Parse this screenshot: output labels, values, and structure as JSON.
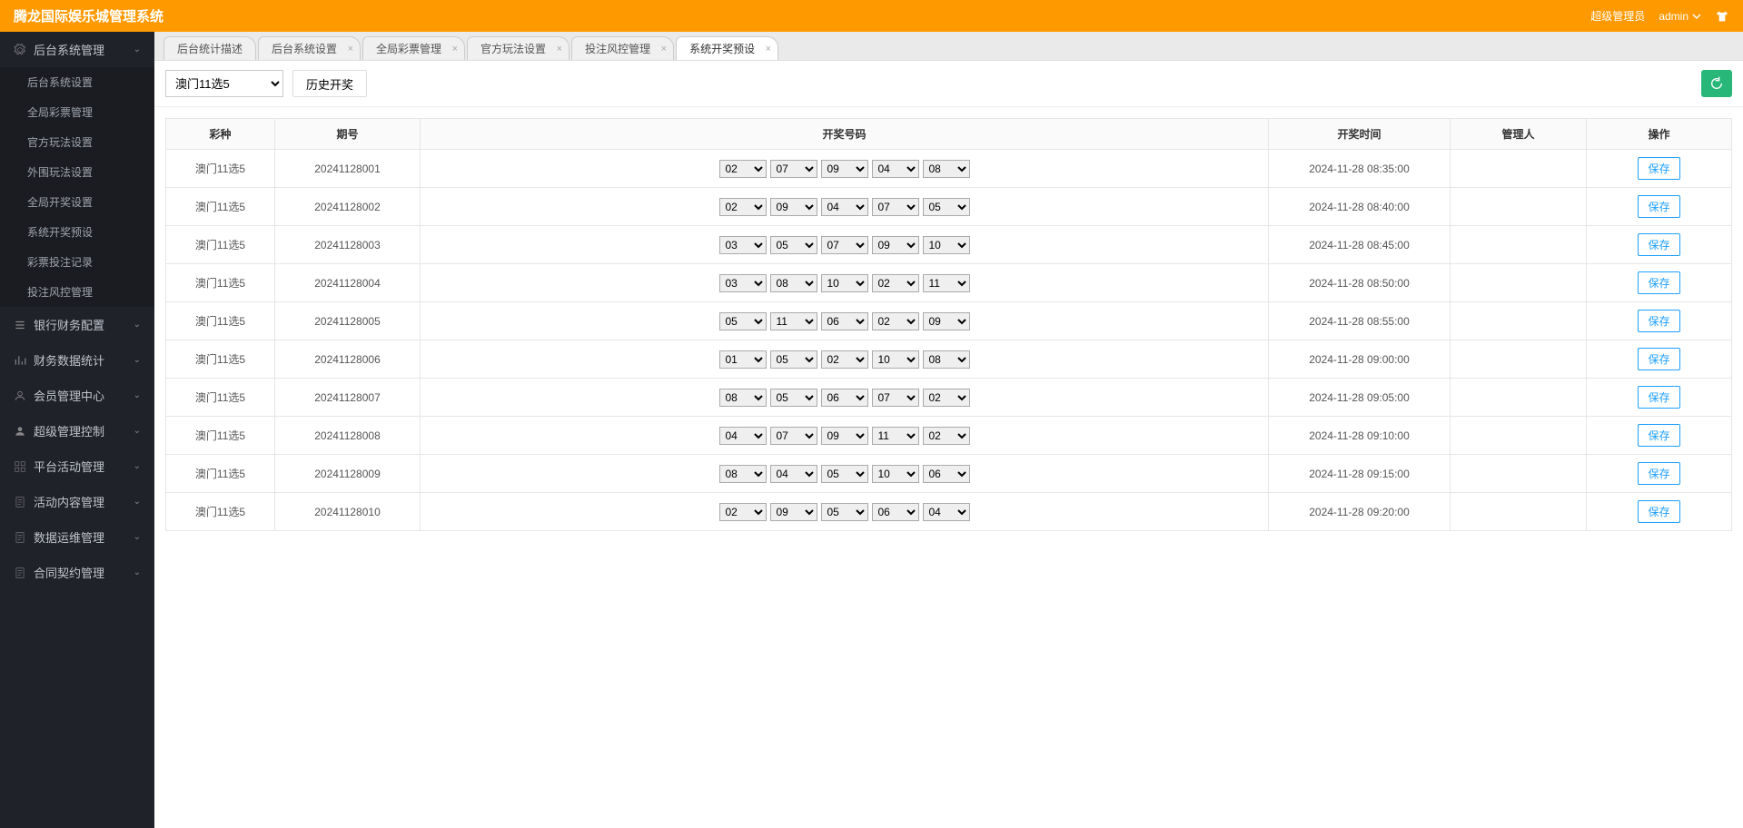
{
  "header": {
    "title": "腾龙国际娱乐城管理系统",
    "user_role": "超级管理员",
    "user_name": "admin"
  },
  "sidebar": [
    {
      "label": "后台系统管理",
      "icon": "gear",
      "expanded": true,
      "items": [
        "后台系统设置",
        "全局彩票管理",
        "官方玩法设置",
        "外围玩法设置",
        "全局开奖设置",
        "系统开奖预设",
        "彩票投注记录",
        "投注风控管理"
      ]
    },
    {
      "label": "银行财务配置",
      "icon": "list",
      "expanded": false
    },
    {
      "label": "财务数据统计",
      "icon": "chart",
      "expanded": false
    },
    {
      "label": "会员管理中心",
      "icon": "user",
      "expanded": false
    },
    {
      "label": "超级管理控制",
      "icon": "person",
      "expanded": false
    },
    {
      "label": "平台活动管理",
      "icon": "grid",
      "expanded": false
    },
    {
      "label": "活动内容管理",
      "icon": "doc",
      "expanded": false
    },
    {
      "label": "数据运维管理",
      "icon": "doc",
      "expanded": false
    },
    {
      "label": "合同契约管理",
      "icon": "doc",
      "expanded": false
    }
  ],
  "tabs": [
    {
      "label": "后台统计描述",
      "closable": false,
      "active": false
    },
    {
      "label": "后台系统设置",
      "closable": true,
      "active": false
    },
    {
      "label": "全局彩票管理",
      "closable": true,
      "active": false
    },
    {
      "label": "官方玩法设置",
      "closable": true,
      "active": false
    },
    {
      "label": "投注风控管理",
      "closable": true,
      "active": false
    },
    {
      "label": "系统开奖预设",
      "closable": true,
      "active": true
    }
  ],
  "toolbar": {
    "lottery_selected": "澳门11选5",
    "history_label": "历史开奖"
  },
  "table": {
    "headers": [
      "彩种",
      "期号",
      "开奖号码",
      "开奖时间",
      "管理人",
      "操作"
    ],
    "save_label": "保存",
    "rows": [
      {
        "type": "澳门11选5",
        "issue": "20241128001",
        "nums": [
          "02",
          "07",
          "09",
          "04",
          "08"
        ],
        "time": "2024-11-28 08:35:00",
        "admin": ""
      },
      {
        "type": "澳门11选5",
        "issue": "20241128002",
        "nums": [
          "02",
          "09",
          "04",
          "07",
          "05"
        ],
        "time": "2024-11-28 08:40:00",
        "admin": ""
      },
      {
        "type": "澳门11选5",
        "issue": "20241128003",
        "nums": [
          "03",
          "05",
          "07",
          "09",
          "10"
        ],
        "time": "2024-11-28 08:45:00",
        "admin": ""
      },
      {
        "type": "澳门11选5",
        "issue": "20241128004",
        "nums": [
          "03",
          "08",
          "10",
          "02",
          "11"
        ],
        "time": "2024-11-28 08:50:00",
        "admin": ""
      },
      {
        "type": "澳门11选5",
        "issue": "20241128005",
        "nums": [
          "05",
          "11",
          "06",
          "02",
          "09"
        ],
        "time": "2024-11-28 08:55:00",
        "admin": ""
      },
      {
        "type": "澳门11选5",
        "issue": "20241128006",
        "nums": [
          "01",
          "05",
          "02",
          "10",
          "08"
        ],
        "time": "2024-11-28 09:00:00",
        "admin": ""
      },
      {
        "type": "澳门11选5",
        "issue": "20241128007",
        "nums": [
          "08",
          "05",
          "06",
          "07",
          "02"
        ],
        "time": "2024-11-28 09:05:00",
        "admin": ""
      },
      {
        "type": "澳门11选5",
        "issue": "20241128008",
        "nums": [
          "04",
          "07",
          "09",
          "11",
          "02"
        ],
        "time": "2024-11-28 09:10:00",
        "admin": ""
      },
      {
        "type": "澳门11选5",
        "issue": "20241128009",
        "nums": [
          "08",
          "04",
          "05",
          "10",
          "06"
        ],
        "time": "2024-11-28 09:15:00",
        "admin": ""
      },
      {
        "type": "澳门11选5",
        "issue": "20241128010",
        "nums": [
          "02",
          "09",
          "05",
          "06",
          "04"
        ],
        "time": "2024-11-28 09:20:00",
        "admin": ""
      }
    ]
  }
}
